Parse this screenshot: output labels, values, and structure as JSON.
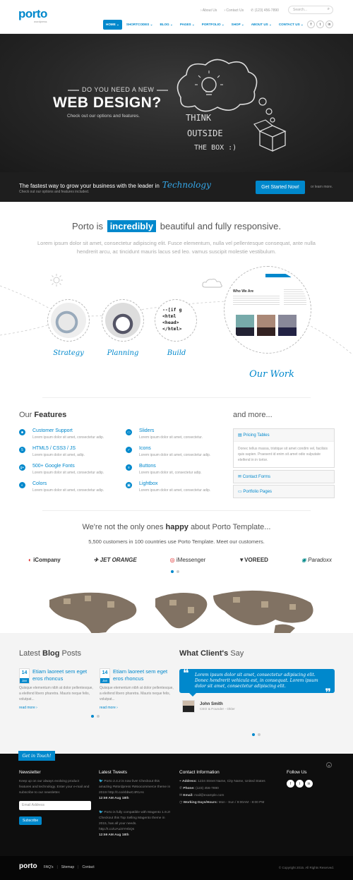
{
  "header": {
    "logo": "porto",
    "logo_sub": "wordpress",
    "top_links": [
      "› About Us",
      "› Contact Us",
      "✆ (123) 456-7890"
    ],
    "search_placeholder": "Search...",
    "nav": [
      "HOME ⌄",
      "SHORTCODES ⌄",
      "BLOG ⌄",
      "PAGES ⌄",
      "PORTFOLIO ⌄",
      "SHOP ⌄",
      "ABOUT US ⌄",
      "CONTACT US ⌄"
    ],
    "social": [
      "f",
      "t",
      "in"
    ]
  },
  "hero": {
    "pre": "DO YOU NEED A NEW",
    "title": "WEB DESIGN?",
    "sub": "Check out our options and features.",
    "chalk_1": "THINK",
    "chalk_2": "OUTSIDE",
    "chalk_3": "THE BOX :)"
  },
  "cta": {
    "main": "The fastest way to grow your business with the leader in",
    "highlight": "Technology",
    "sub": "Check out our options and features included.",
    "button": "Get Started Now!",
    "more": "or learn more."
  },
  "intro": {
    "title_pre": "Porto is",
    "title_hl": "incredibly",
    "title_post": "beautiful and fully responsive.",
    "text": "Lorem ipsum dolor sit amet, consectetur adipiscing elit. Fusce elementum, nulla vel pellentesque consequat, ante nulla hendrerit arcu, ac tincidunt mauris lacus sed leo. vamus suscipit molestie vestibulum."
  },
  "steps": {
    "strategy": "Strategy",
    "planning": "Planning",
    "build": "Build",
    "work": "Our Work",
    "who_we_are": "Who We Are",
    "code_lines": [
      "--[if g",
      "<html",
      "<head>",
      "</html>"
    ]
  },
  "features": {
    "title_pre": "Our",
    "title_bold": "Features",
    "items": [
      {
        "icon": "☻",
        "title": "Customer Support",
        "desc": "Lorem ipsum dolor sit amet, consectetur adip."
      },
      {
        "icon": "5",
        "title": "HTML5 / CSS3 / JS",
        "desc": "Lorem ipsum dolor sit amet, adip."
      },
      {
        "icon": "g+",
        "title": "500+ Google Fonts",
        "desc": "Lorem ipsum dolor sit amet, consectetur adip."
      },
      {
        "icon": "◐",
        "title": "Colors",
        "desc": "Lorem ipsum dolor sit amet, consectetur adip."
      },
      {
        "icon": "▭",
        "title": "Sliders",
        "desc": "Lorem ipsum dolor sit amet, consectetur."
      },
      {
        "icon": "✓",
        "title": "Icons",
        "desc": "Lorem ipsum dolor sit amet, consectetur adip."
      },
      {
        "icon": "≡",
        "title": "Buttons",
        "desc": "Lorem ipsum dolor sit, consectetur adip."
      },
      {
        "icon": "▣",
        "title": "Lightbox",
        "desc": "Lorem ipsum dolor sit amet, consectetur adip."
      }
    ]
  },
  "more": {
    "title": "and more...",
    "items": [
      {
        "label": "Pricing Tables",
        "icon": "▤"
      },
      {
        "label": "Contact Forms",
        "icon": "✉"
      },
      {
        "label": "Portfolio Pages",
        "icon": "▭"
      }
    ],
    "body": "Donec tellus massa, tristique sit amet condim vel, facilisis quis sapien. Praesent id enim sit amet odio vulputate eleifend in in tortor."
  },
  "happy": {
    "pre": "We're not the only ones",
    "bold": "happy",
    "post": "about Porto Template...",
    "sub": "5,500 customers in 100 countries use Porto Template. Meet our customers."
  },
  "clients": [
    "iCompany",
    "JET ORANGE",
    "iMessenger",
    "VOREED",
    "Paradoxx"
  ],
  "blog": {
    "title_pre": "Latest",
    "title_bold": "Blog",
    "title_post": "Posts",
    "posts": [
      {
        "day": "14",
        "mon": "Jan",
        "title": "Etiam laoreet sem eget eros rhoncus",
        "desc": "Quisque elementum nibh at dolor pellentesque, a eleifend libero pharetra. Mauris neque felis, volutpat...",
        "more": "read more ›"
      },
      {
        "day": "14",
        "mon": "Jan",
        "title": "Etiam laoreet sem eget eros rhoncus",
        "desc": "Quisque elementum nibh at dolor pellentesque, a eleifend libero pharetra. Mauris neque felis, volutpat...",
        "more": "read more ›"
      }
    ]
  },
  "clients_say": {
    "title_pre": "What",
    "title_bold": "Client's",
    "title_post": "Say",
    "quote": "Lorem ipsum dolor sit amet, consectetur adipiscing elit. Donec hendrerit vehicula est, in consequat. Lorem ipsum dolor sit amet, consectetur adipiscing elit.",
    "name": "John Smith",
    "role": "CEO & Founder - Okler"
  },
  "footer": {
    "ribbon": "Get in Touch!",
    "newsletter_title": "Newsletter",
    "newsletter_text": "Keep up on our always evolving product features and technology. Enter your e-mail and subscribe to our newsletter.",
    "email_placeholder": "Email Address",
    "subscribe": "Subscribe",
    "tweets_title": "Latest Tweets",
    "tweet1": "Porto 2.4.2 is now live! Checkout this amazing #Wordpress #Woocommerce theme in 2015! http://t.co/ebbwC4R1As",
    "tweet1_time": "12:59 AM Aug 18th",
    "tweet2": "Porto is fully compatible with Magento 1.9.2! Checkout this Top Selling Magento theme in 2015, has all your needs. http://t.co/UAuiSYHbQs",
    "tweet2_time": "12:59 AM Aug 18th",
    "contact_title": "Contact Information",
    "address_label": "Address:",
    "address": "1234 Street Name, City Name, United States",
    "phone_label": "Phone:",
    "phone": "(123) 456-7890",
    "email_label": "Email:",
    "email": "mail@example.com",
    "hours_label": "Working Days/Hours:",
    "hours": "Mon - Sun / 9:00AM - 8:00 PM",
    "follow_title": "Follow Us",
    "social": [
      "f",
      "t",
      "in"
    ]
  },
  "copyright": {
    "logo": "porto",
    "links": [
      "FAQ's",
      "Sitemap",
      "Contact"
    ],
    "text": "© Copyright 2015. All Rights Reserved."
  },
  "colors": {
    "accent": "#0088cc",
    "dark": "#1e1e1e",
    "footer": "#0e0e0e"
  }
}
